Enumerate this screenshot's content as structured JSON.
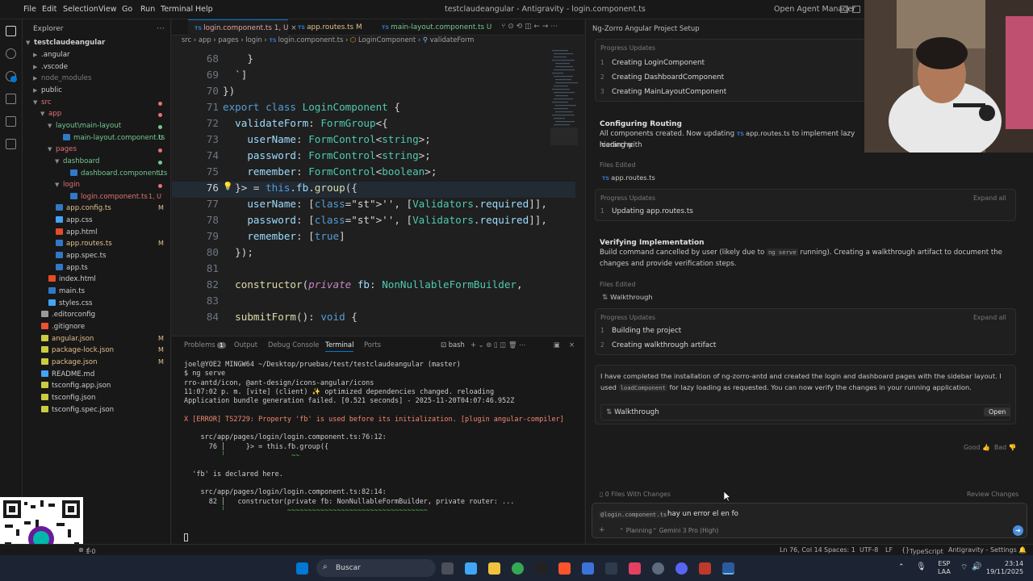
{
  "menubar": {
    "items": [
      "File",
      "Edit",
      "Selection",
      "View",
      "Go",
      "Run",
      "Terminal",
      "Help"
    ],
    "window_title": "testclaudeangular - Antigravity - login.component.ts",
    "open_agent_manager": "Open Agent Manager"
  },
  "explorer": {
    "header": "Explorer",
    "root": "testclaudeangular",
    "rows": [
      {
        "label": ".angular",
        "kind": "folder",
        "depth": 1,
        "color": "#cccccc",
        "badge": ""
      },
      {
        "label": ".vscode",
        "kind": "folder",
        "depth": 1,
        "color": "#cccccc",
        "badge": ""
      },
      {
        "label": "node_modules",
        "kind": "folder",
        "depth": 1,
        "color": "#7c7c7c",
        "badge": ""
      },
      {
        "label": "public",
        "kind": "folder",
        "depth": 1,
        "color": "#cccccc",
        "badge": ""
      },
      {
        "label": "src",
        "kind": "folder-open",
        "depth": 1,
        "color": "#e57373",
        "badge": ""
      },
      {
        "label": "app",
        "kind": "folder-open",
        "depth": 2,
        "color": "#e57373",
        "badge": ""
      },
      {
        "label": "layout\\main-layout",
        "kind": "folder-open",
        "depth": 3,
        "color": "#73c991",
        "badge": ""
      },
      {
        "label": "main-layout.component.ts",
        "kind": "ts",
        "depth": 4,
        "color": "#73c991",
        "badge": "U"
      },
      {
        "label": "pages",
        "kind": "folder-open",
        "depth": 3,
        "color": "#e57373",
        "badge": ""
      },
      {
        "label": "dashboard",
        "kind": "folder-open",
        "depth": 4,
        "color": "#73c991",
        "badge": ""
      },
      {
        "label": "dashboard.component.ts",
        "kind": "ts",
        "depth": 5,
        "color": "#73c991",
        "badge": "U"
      },
      {
        "label": "login",
        "kind": "folder-open",
        "depth": 4,
        "color": "#e57373",
        "badge": ""
      },
      {
        "label": "login.component.ts",
        "kind": "ts",
        "depth": 5,
        "color": "#e57373",
        "badge": "1, U"
      },
      {
        "label": "app.config.ts",
        "kind": "ts",
        "depth": 3,
        "color": "#e2c08d",
        "badge": "M"
      },
      {
        "label": "app.css",
        "kind": "css",
        "depth": 3,
        "color": "#cccccc",
        "badge": ""
      },
      {
        "label": "app.html",
        "kind": "html",
        "depth": 3,
        "color": "#cccccc",
        "badge": ""
      },
      {
        "label": "app.routes.ts",
        "kind": "ts",
        "depth": 3,
        "color": "#e2c08d",
        "badge": "M"
      },
      {
        "label": "app.spec.ts",
        "kind": "ts",
        "depth": 3,
        "color": "#cccccc",
        "badge": ""
      },
      {
        "label": "app.ts",
        "kind": "ts",
        "depth": 3,
        "color": "#cccccc",
        "badge": ""
      },
      {
        "label": "index.html",
        "kind": "html",
        "depth": 2,
        "color": "#cccccc",
        "badge": ""
      },
      {
        "label": "main.ts",
        "kind": "ts",
        "depth": 2,
        "color": "#cccccc",
        "badge": ""
      },
      {
        "label": "styles.css",
        "kind": "css",
        "depth": 2,
        "color": "#cccccc",
        "badge": ""
      },
      {
        "label": ".editorconfig",
        "kind": "config",
        "depth": 1,
        "color": "#cccccc",
        "badge": ""
      },
      {
        "label": ".gitignore",
        "kind": "git",
        "depth": 1,
        "color": "#cccccc",
        "badge": ""
      },
      {
        "label": "angular.json",
        "kind": "json",
        "depth": 1,
        "color": "#e2c08d",
        "badge": "M"
      },
      {
        "label": "package-lock.json",
        "kind": "json",
        "depth": 1,
        "color": "#e2c08d",
        "badge": "M"
      },
      {
        "label": "package.json",
        "kind": "json",
        "depth": 1,
        "color": "#e2c08d",
        "badge": "M"
      },
      {
        "label": "README.md",
        "kind": "md",
        "depth": 1,
        "color": "#cccccc",
        "badge": ""
      },
      {
        "label": "tsconfig.app.json",
        "kind": "json",
        "depth": 1,
        "color": "#cccccc",
        "badge": ""
      },
      {
        "label": "tsconfig.json",
        "kind": "json",
        "depth": 1,
        "color": "#cccccc",
        "badge": ""
      },
      {
        "label": "tsconfig.spec.json",
        "kind": "json",
        "depth": 1,
        "color": "#cccccc",
        "badge": ""
      }
    ]
  },
  "editor": {
    "tabs": [
      {
        "label": "login.component.ts",
        "suffix": "1, U",
        "active": true
      },
      {
        "label": "app.routes.ts",
        "suffix": "M",
        "active": false
      },
      {
        "label": "main-layout.component.ts",
        "suffix": "U",
        "active": false
      }
    ],
    "breadcrumb": [
      "src",
      "app",
      "pages",
      "login",
      "login.component.ts",
      "LoginComponent",
      "validateForm"
    ],
    "lines": [
      {
        "n": "68",
        "text": "    }"
      },
      {
        "n": "69",
        "text": "  `]"
      },
      {
        "n": "70",
        "text": "})"
      },
      {
        "n": "71",
        "text": "export class LoginComponent {"
      },
      {
        "n": "72",
        "text": "  validateForm: FormGroup<{"
      },
      {
        "n": "73",
        "text": "    userName: FormControl<string>;"
      },
      {
        "n": "74",
        "text": "    password: FormControl<string>;"
      },
      {
        "n": "75",
        "text": "    remember: FormControl<boolean>;"
      },
      {
        "n": "76",
        "text": "  }> = this.fb.group({"
      },
      {
        "n": "77",
        "text": "    userName: ['', [Validators.required]],"
      },
      {
        "n": "78",
        "text": "    password: ['', [Validators.required]],"
      },
      {
        "n": "79",
        "text": "    remember: [true]"
      },
      {
        "n": "80",
        "text": "  });"
      },
      {
        "n": "81",
        "text": ""
      },
      {
        "n": "82",
        "text": "  constructor(private fb: NonNullableFormBuilder,"
      },
      {
        "n": "83",
        "text": ""
      },
      {
        "n": "84",
        "text": "  submitForm(): void {"
      }
    ]
  },
  "panel": {
    "tabs": [
      "Problems",
      "Output",
      "Debug Console",
      "Terminal",
      "Ports"
    ],
    "problems_count": "1",
    "active_tab": "Terminal",
    "shell": "bash",
    "terminal": [
      {
        "text": "joel@YOE2 MINGW64 ~/Desktop/pruebas/test/testclaudeangular (master)",
        "color": "#cccccc"
      },
      {
        "text": "$ ng serve",
        "color": "#cccccc"
      },
      {
        "text": "rro-antd/icon, @ant-design/icons-angular/icons",
        "color": "#cccccc"
      },
      {
        "text": "11:07:02 p. m. [vite] (client) ✨ optimized dependencies changed. reloading",
        "color": "#cccccc"
      },
      {
        "text": "Application bundle generation failed. [0.521 seconds] - 2025-11-20T04:07:46.952Z",
        "color": "#cccccc"
      },
      {
        "text": "",
        "color": "#cccccc"
      },
      {
        "text": "X [ERROR] TS2729: Property 'fb' is used before its initialization. [plugin angular-compiler]",
        "color": "#f48771"
      },
      {
        "text": "",
        "color": "#cccccc"
      },
      {
        "text": "    src/app/pages/login/login.component.ts:76:12:",
        "color": "#cccccc"
      },
      {
        "text": "      76 │     }> = this.fb.group({",
        "color": "#cccccc"
      },
      {
        "text": "         ╵                ~~",
        "color": "#4ec94e"
      },
      {
        "text": "",
        "color": "#cccccc"
      },
      {
        "text": "  'fb' is declared here.",
        "color": "#cccccc"
      },
      {
        "text": "",
        "color": "#cccccc"
      },
      {
        "text": "    src/app/pages/login/login.component.ts:82:14:",
        "color": "#cccccc"
      },
      {
        "text": "      82 │   constructor(private fb: NonNullableFormBuilder, private router: ...",
        "color": "#cccccc"
      },
      {
        "text": "         ╵               ~~~~~~~~~~~~~~~~~~~~~~~~~~~~~~~~~~",
        "color": "#4ec94e"
      }
    ]
  },
  "agent": {
    "title": "Ng-Zorro Angular Project Setup",
    "progress_label": "Progress Updates",
    "expand_all": "Expand all",
    "files_edited_label": "Files Edited",
    "top_items": [
      "Creating LoginComponent",
      "Creating DashboardComponent",
      "Creating MainLayoutComponent"
    ],
    "top_nums": [
      "1",
      "2",
      "3"
    ],
    "section1": {
      "heading": "Configuring Routing",
      "text_before": "All components created. Now updating",
      "file_inline": "app.routes.ts",
      "text_after": "to implement lazy loading with",
      "text_line2": "hierarchy.",
      "file_edited": "app.routes.ts",
      "items": [
        "Updating app.routes.ts"
      ],
      "nums": [
        "1"
      ]
    },
    "section2": {
      "heading": "Verifying Implementation",
      "text_a": "Build command cancelled by user (likely due to",
      "code": "ng serve",
      "text_b": "running). Creating a walkthrough artifact to document the changes and",
      "text_c": "provide verification steps.",
      "file_edited": "Walkthrough",
      "items": [
        "Building the project",
        "Creating walkthrough artifact"
      ],
      "nums": [
        "1",
        "2"
      ]
    },
    "summary": {
      "text_a": "I have completed the installation of ng-zorro-antd and created the login and dashboard pages with the sidebar layout. I used",
      "code": "loadComponent",
      "text_b": "for lazy loading as requested. You can now verify the changes in your running application.",
      "artifact": "Walkthrough",
      "open_label": "Open"
    },
    "feedback": {
      "good": "Good",
      "bad": "Bad"
    },
    "files_with_changes": "0 Files With Changes",
    "review_changes": "Review Changes",
    "chat": {
      "context_chip": "@login.component.ts",
      "input_value": "hay un error el en fo",
      "mode": "Planning",
      "model": "Gemini 3 Pro (High)"
    }
  },
  "statusbar": {
    "errors": "1",
    "warnings": "0",
    "position": "Ln 76, Col 14",
    "spaces": "Spaces: 1",
    "encoding": "UTF-8",
    "eol": "LF",
    "language": "TypeScript",
    "settings": "Antigravity - Settings"
  },
  "taskbar": {
    "search_placeholder": "Buscar",
    "lang_top": "ESP",
    "lang_bottom": "LAA",
    "time": "23:14",
    "date": "19/11/2025"
  },
  "colors": {
    "accent": "#0078d4",
    "error": "#f48771",
    "modified": "#e2c08d",
    "untracked": "#73c991"
  }
}
